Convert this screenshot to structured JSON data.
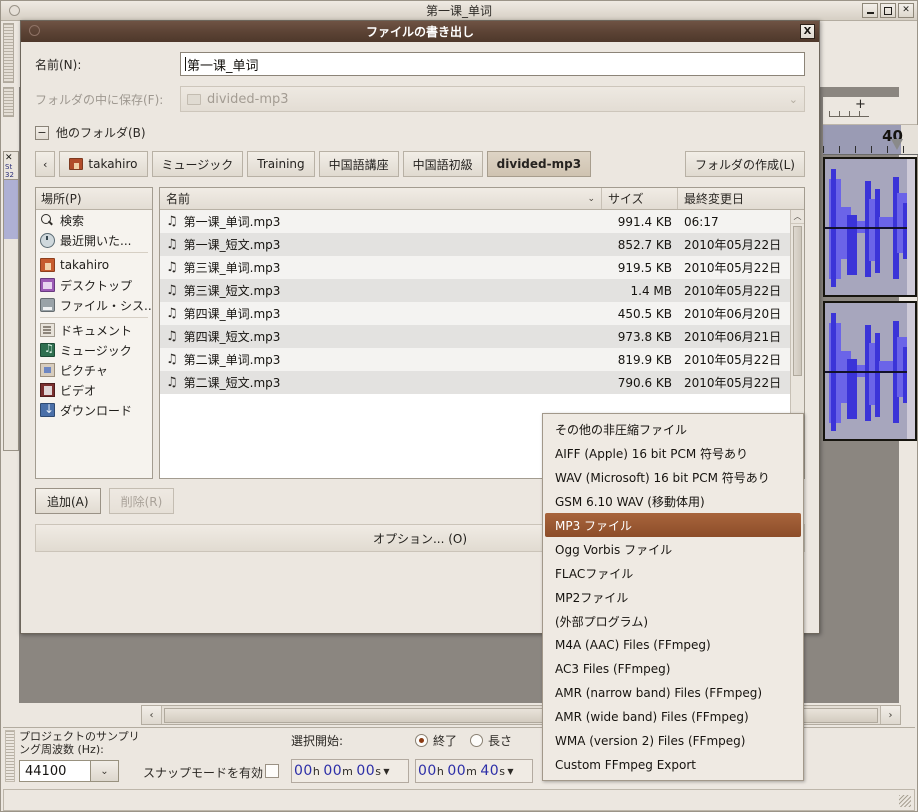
{
  "app": {
    "title": "第一课_单词",
    "window_buttons": {
      "minimize": "_",
      "maximize": "□",
      "close": "✕"
    },
    "ruler_value": "40",
    "scroll_left": "‹",
    "scroll_right": "›"
  },
  "selection_bar": {
    "sample_rate_label": "プロジェクトのサンプリング周波数 (Hz):",
    "sample_rate_value": "44100",
    "sample_rate_chevron": "⌄",
    "snap_label": "スナップモードを有効",
    "selection_start_label": "選択開始:",
    "radio_end_label": "終了",
    "radio_length_label": "長さ",
    "time_start": {
      "h": "00",
      "h_unit": "h",
      "m": "00",
      "m_unit": "m",
      "s": "00",
      "s_unit": "s",
      "caret": "▼"
    },
    "time_end": {
      "h": "00",
      "h_unit": "h",
      "m": "00",
      "m_unit": "m",
      "s": "40",
      "s_unit": "s",
      "caret": "▼"
    }
  },
  "dialog": {
    "title": "ファイルの書き出し",
    "close_label": "X",
    "name_label": "名前(N):",
    "name_value": "第一课_单词",
    "save_in_label": "フォルダの中に保存(F):",
    "save_in_value": "divided-mp3",
    "save_in_chevron": "⌄",
    "expander_sign": "−",
    "expander_label": "他のフォルダ(B)",
    "breadcrumbs": [
      {
        "label": "‹",
        "type": "nav"
      },
      {
        "label": "takahiro",
        "type": "home"
      },
      {
        "label": "ミュージック",
        "type": "plain"
      },
      {
        "label": "Training",
        "type": "plain"
      },
      {
        "label": "中国語講座",
        "type": "plain"
      },
      {
        "label": "中国語初級",
        "type": "plain"
      },
      {
        "label": "divided-mp3",
        "type": "current"
      }
    ],
    "create_folder_label": "フォルダの作成(L)",
    "places": {
      "header": "場所(P)",
      "items": [
        {
          "label": "検索",
          "icon": "search-icon"
        },
        {
          "label": "最近開いた...",
          "icon": "recent-clock-icon"
        },
        {
          "label": "takahiro",
          "icon": "home-folder-icon"
        },
        {
          "label": "デスクトップ",
          "icon": "desktop-icon"
        },
        {
          "label": "ファイル・シス...",
          "icon": "filesystem-disk-icon"
        },
        {
          "label": "ドキュメント",
          "icon": "documents-folder-icon"
        },
        {
          "label": "ミュージック",
          "icon": "music-folder-icon"
        },
        {
          "label": "ピクチャ",
          "icon": "pictures-folder-icon"
        },
        {
          "label": "ビデオ",
          "icon": "videos-folder-icon"
        },
        {
          "label": "ダウンロード",
          "icon": "downloads-folder-icon"
        }
      ]
    },
    "file_list": {
      "columns": {
        "name": "名前",
        "size": "サイズ",
        "modified": "最終変更日"
      },
      "sort_chevron": "⌄",
      "scroll_up": "︿",
      "rows": [
        {
          "name": "第一课_单词.mp3",
          "size": "991.4 KB",
          "modified": "06:17"
        },
        {
          "name": "第一课_短文.mp3",
          "size": "852.7 KB",
          "modified": "2010年05月22日"
        },
        {
          "name": "第三课_单词.mp3",
          "size": "919.5 KB",
          "modified": "2010年05月22日"
        },
        {
          "name": "第三课_短文.mp3",
          "size": "1.4 MB",
          "modified": "2010年05月22日"
        },
        {
          "name": "第四课_单词.mp3",
          "size": "450.5 KB",
          "modified": "2010年06月20日"
        },
        {
          "name": "第四课_短文.mp3",
          "size": "973.8 KB",
          "modified": "2010年06月21日"
        },
        {
          "name": "第二课_单词.mp3",
          "size": "819.9 KB",
          "modified": "2010年05月22日"
        },
        {
          "name": "第二课_短文.mp3",
          "size": "790.6 KB",
          "modified": "2010年05月22日"
        }
      ]
    },
    "add_label": "追加(A)",
    "remove_label": "削除(R)",
    "options_label": "オプション... (O)"
  },
  "format_menu": {
    "selected": "MP3 ファイル",
    "items": [
      "その他の非圧縮ファイル",
      "AIFF (Apple) 16 bit PCM 符号あり",
      "WAV (Microsoft) 16 bit PCM 符号あり",
      "GSM 6.10 WAV (移動体用)",
      "MP3 ファイル",
      "Ogg Vorbis ファイル",
      "FLACファイル",
      "MP2ファイル",
      "(外部プログラム)",
      "M4A (AAC) Files (FFmpeg)",
      "AC3 Files (FFmpeg)",
      "AMR (narrow band) Files (FFmpeg)",
      "AMR (wide band) Files (FFmpeg)",
      "WMA (version 2) Files (FFmpeg)",
      "Custom FFmpeg Export"
    ]
  },
  "colors": {
    "dialog_titlebar": "#5b4234",
    "menu_highlight": "#8c4d29",
    "waveform": "#3b34d8",
    "track_background": "#a7a6bd",
    "window_background": "#ece7e0"
  }
}
